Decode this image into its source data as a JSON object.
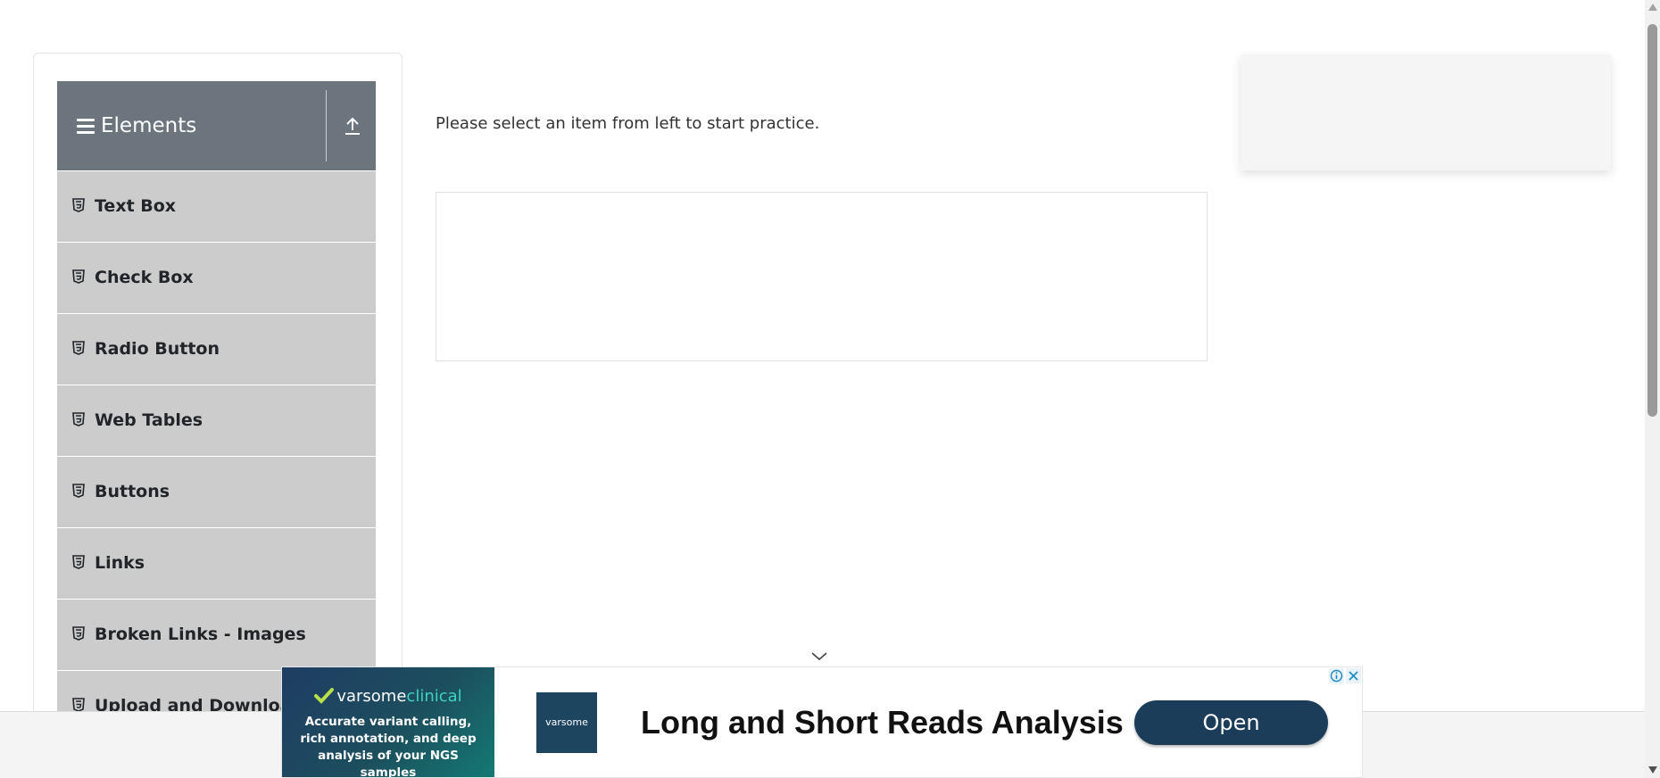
{
  "sidebar": {
    "group_title": "Elements",
    "items": [
      {
        "label": "Text Box"
      },
      {
        "label": "Check Box"
      },
      {
        "label": "Radio Button"
      },
      {
        "label": "Web Tables"
      },
      {
        "label": "Buttons"
      },
      {
        "label": "Links"
      },
      {
        "label": "Broken Links - Images"
      },
      {
        "label": "Upload and Download"
      }
    ]
  },
  "main": {
    "intro_text": "Please select an item from left to start practice."
  },
  "ad": {
    "brand_part1": "varsome",
    "brand_part2": "clinical",
    "description": "Accurate variant calling, rich annotation, and deep analysis of your NGS samples",
    "thumb_text": "varsome",
    "headline": "Long and Short Reads Analysis",
    "cta_label": "Open"
  },
  "colors": {
    "header_bg": "#6c757d",
    "menu_item_bg": "#cccccc",
    "ad_cta_bg": "#1c3d5a"
  },
  "icons": {
    "menu_toggle": "hamburger-icon",
    "collapse": "upload-arrow-icon",
    "menu_item": "html5-icon",
    "ad_info": "info-icon",
    "ad_close": "close-icon"
  }
}
